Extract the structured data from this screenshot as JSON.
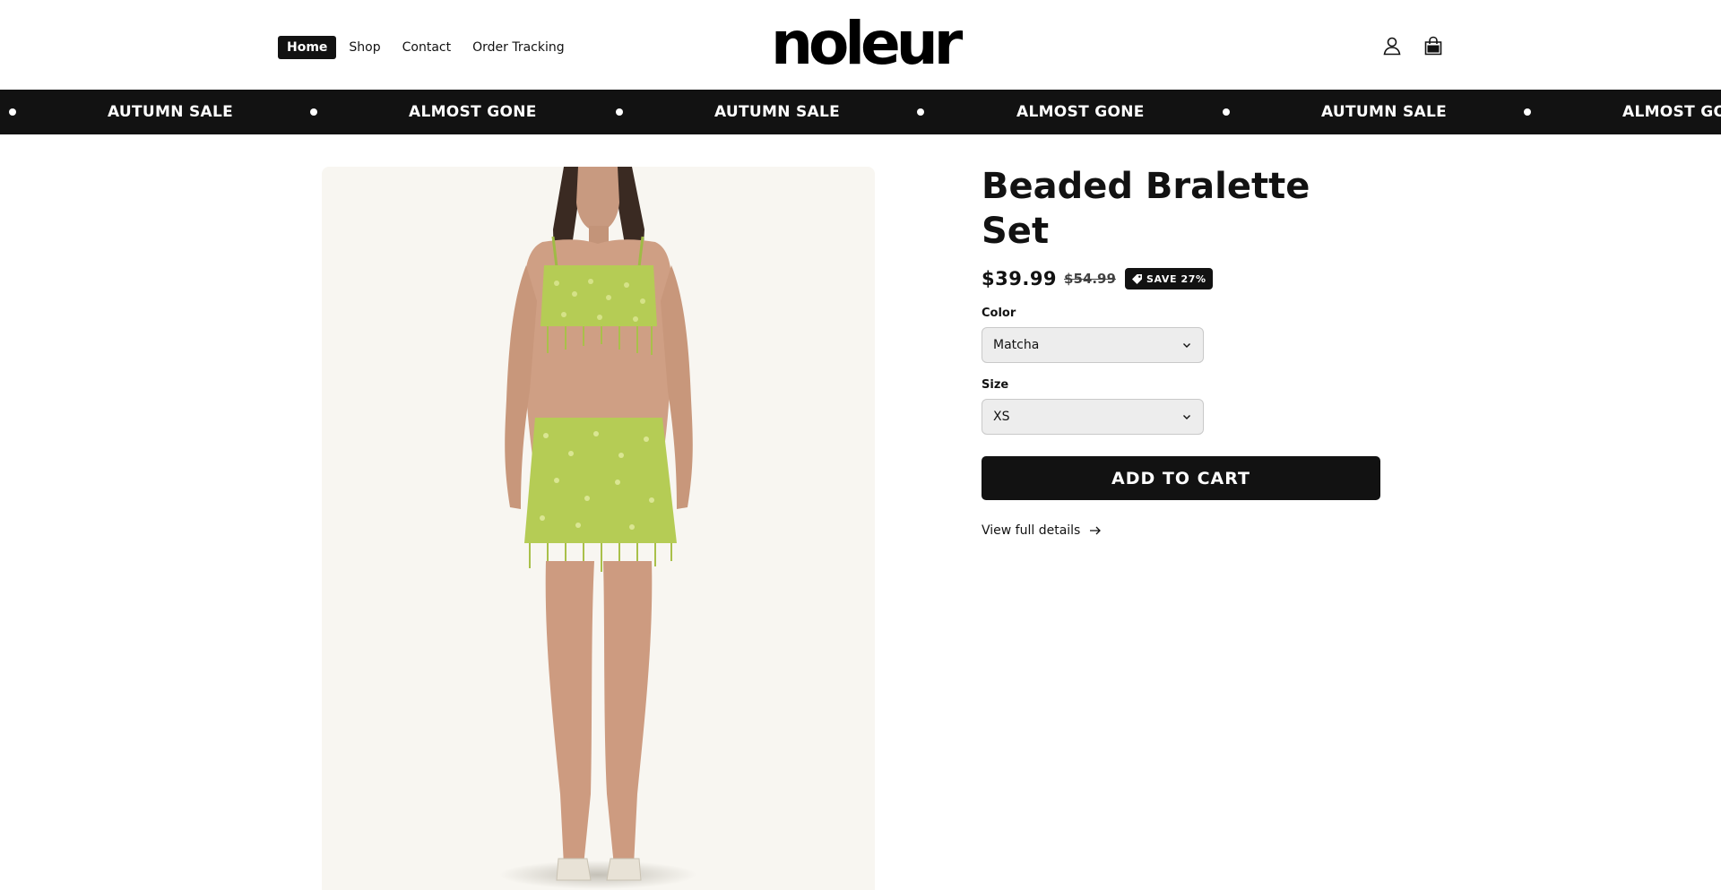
{
  "header": {
    "nav": [
      {
        "label": "Home",
        "active": true
      },
      {
        "label": "Shop"
      },
      {
        "label": "Contact"
      },
      {
        "label": "Order Tracking"
      }
    ],
    "logo": "noleur",
    "icons": [
      "account-icon",
      "cart-icon"
    ]
  },
  "announcement": {
    "items": [
      "AUTUMN SALE",
      "ALMOST GONE",
      "AUTUMN SALE",
      "ALMOST GONE",
      "AUTUMN SALE",
      "ALMOST GONE"
    ]
  },
  "product": {
    "title": "Beaded Bralette Set",
    "price": "$39.99",
    "compare_price": "$54.99",
    "badge": "SAVE 27%",
    "color_label": "Color",
    "color_value": "Matcha",
    "size_label": "Size",
    "size_value": "XS",
    "add_to_cart": "ADD TO CART",
    "details_link": "View full details"
  },
  "colors": {
    "primary": "#121212",
    "image_bg": "#f8f6f1",
    "outfit": "#b5cc55"
  }
}
